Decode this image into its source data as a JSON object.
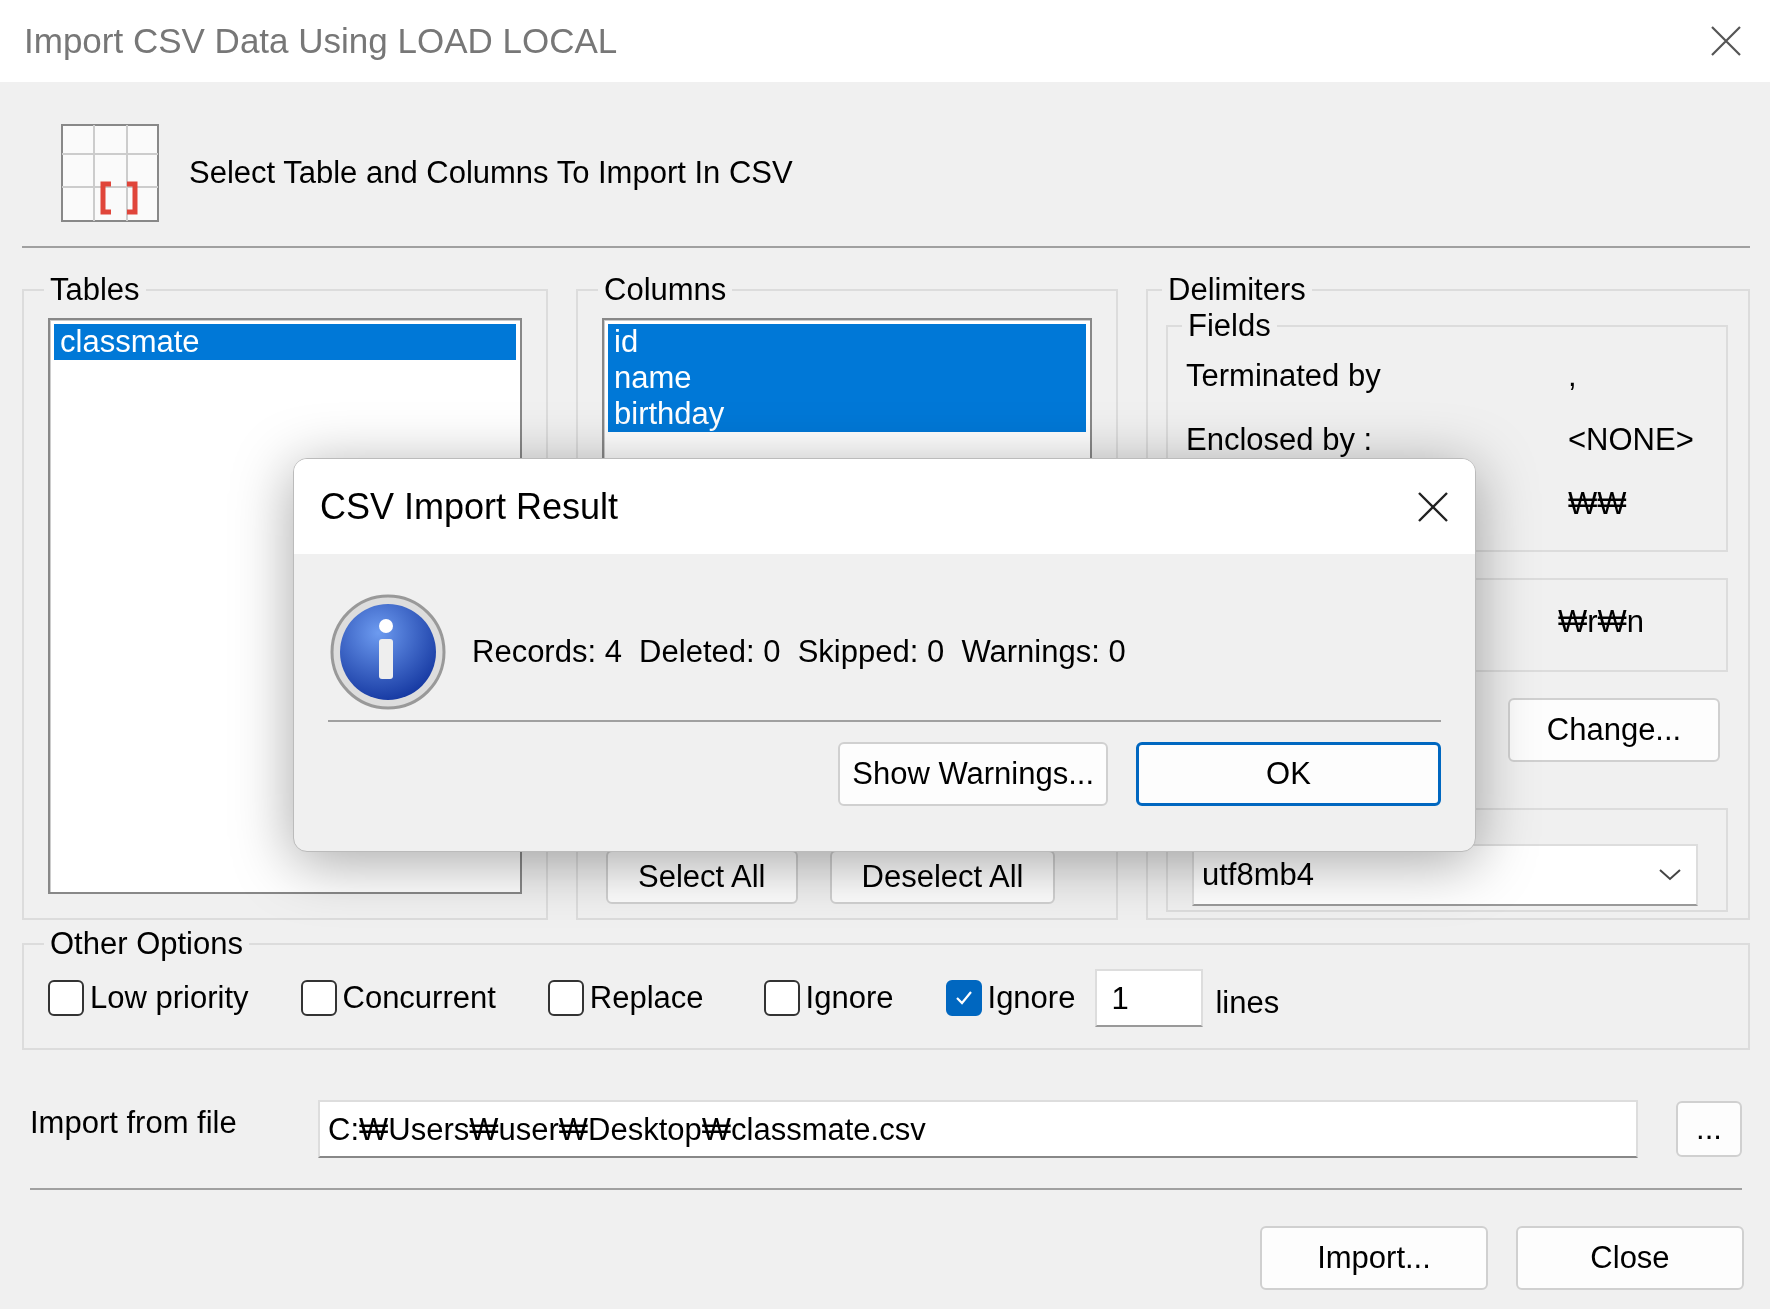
{
  "window": {
    "title": "Import CSV Data Using LOAD LOCAL"
  },
  "header": {
    "text": "Select Table and Columns To Import In CSV"
  },
  "tables": {
    "label": "Tables",
    "items": [
      {
        "text": "classmate",
        "selected": true
      }
    ]
  },
  "columns": {
    "label": "Columns",
    "items": [
      {
        "text": "id",
        "selected": true
      },
      {
        "text": "name",
        "selected": true
      },
      {
        "text": "birthday",
        "selected": true
      }
    ],
    "buttons": [
      "Select All",
      "Deselect All"
    ]
  },
  "delimiters": {
    "label": "Delimiters",
    "fields": {
      "label": "Fields",
      "rows": [
        {
          "label": "Terminated by",
          "value": ","
        },
        {
          "label": "Enclosed by :",
          "value": "<NONE>"
        },
        {
          "value": "₩₩"
        }
      ]
    },
    "lines": {
      "value": "₩r₩n"
    },
    "change_button": "Change...",
    "encoding": {
      "value": "utf8mb4"
    }
  },
  "other_options": {
    "label": "Other Options",
    "options": [
      {
        "kind": "checkbox",
        "label": "Low priority",
        "checked": false
      },
      {
        "kind": "checkbox",
        "label": "Concurrent",
        "checked": false
      },
      {
        "kind": "checkbox",
        "label": "Replace",
        "checked": false
      },
      {
        "kind": "checkbox",
        "label": "Ignore",
        "checked": false
      },
      {
        "kind": "checkbox-count",
        "label": "Ignore",
        "checked": true,
        "count": "1",
        "unit": "lines"
      }
    ]
  },
  "import_file": {
    "label": "Import from file",
    "value": "C:₩Users₩user₩Desktop₩classmate.csv",
    "browse_button": "..."
  },
  "buttons": [
    "Import...",
    "Close"
  ],
  "dialog": {
    "title": "CSV Import Result",
    "message": "Records: 4  Deleted: 0  Skipped: 0  Warnings: 0",
    "buttons": [
      {
        "label": "Show Warnings...",
        "default": false
      },
      {
        "label": "OK",
        "default": true
      }
    ]
  }
}
